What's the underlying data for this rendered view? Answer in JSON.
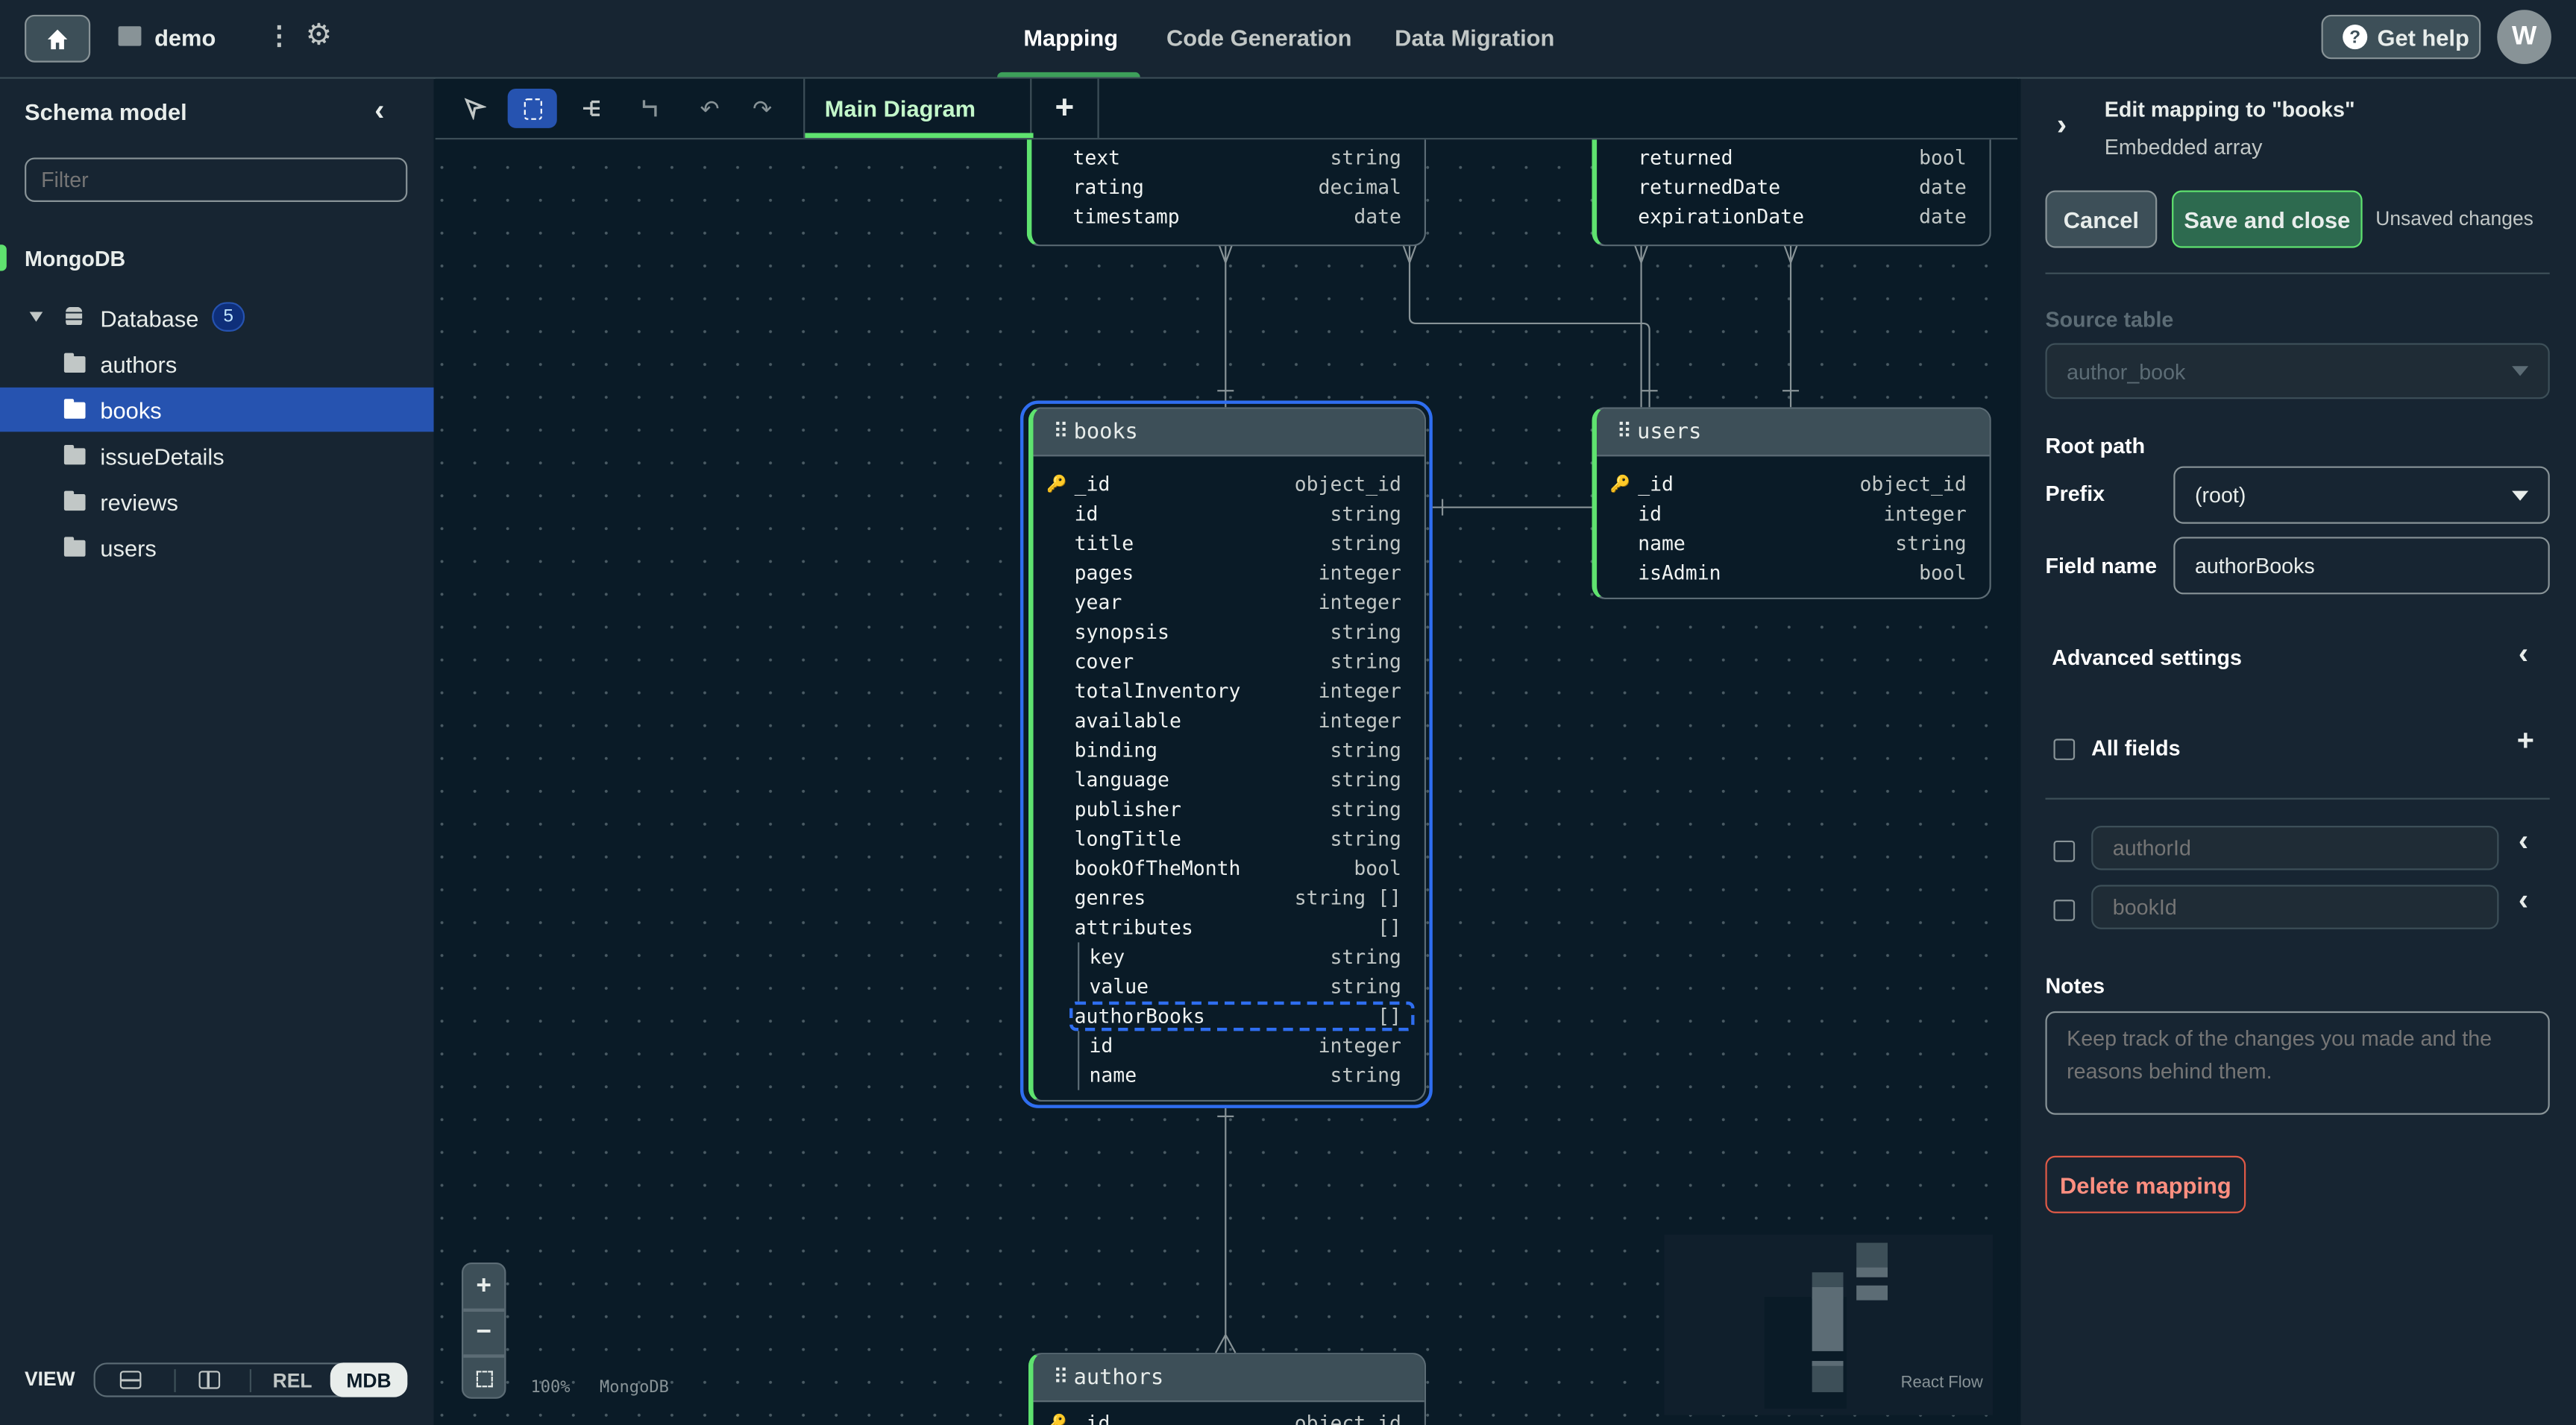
{
  "topbar": {
    "project": "demo",
    "tabs": [
      {
        "label": "Mapping",
        "active": true
      },
      {
        "label": "Code Generation"
      },
      {
        "label": "Data Migration"
      }
    ],
    "help_label": "Get help",
    "avatar_initial": "W"
  },
  "sidebar": {
    "title": "Schema model",
    "filter_placeholder": "Filter",
    "section": "MongoDB",
    "database": {
      "label": "Database",
      "count": "5"
    },
    "items": [
      {
        "label": "authors"
      },
      {
        "label": "books",
        "selected": true
      },
      {
        "label": "issueDetails"
      },
      {
        "label": "reviews"
      },
      {
        "label": "users"
      }
    ],
    "view_label": "VIEW",
    "view_options": [
      "REL",
      "MDB"
    ],
    "view_selected": "MDB"
  },
  "canvas": {
    "tab": "Main Diagram",
    "zoom": "100%",
    "db_label": "MongoDB",
    "minimap_label": "React Flow",
    "tables": {
      "reviews_partial": {
        "fields": [
          {
            "name": "text",
            "type": "string"
          },
          {
            "name": "rating",
            "type": "decimal"
          },
          {
            "name": "timestamp",
            "type": "date"
          }
        ]
      },
      "issue_partial": {
        "fields": [
          {
            "name": "returned",
            "type": "bool"
          },
          {
            "name": "returnedDate",
            "type": "date"
          },
          {
            "name": "expirationDate",
            "type": "date"
          }
        ]
      },
      "books": {
        "name": "books",
        "fields": [
          {
            "name": "_id",
            "type": "object_id",
            "key": true
          },
          {
            "name": "id",
            "type": "string"
          },
          {
            "name": "title",
            "type": "string"
          },
          {
            "name": "pages",
            "type": "integer"
          },
          {
            "name": "year",
            "type": "integer"
          },
          {
            "name": "synopsis",
            "type": "string"
          },
          {
            "name": "cover",
            "type": "string"
          },
          {
            "name": "totalInventory",
            "type": "integer"
          },
          {
            "name": "available",
            "type": "integer"
          },
          {
            "name": "binding",
            "type": "string"
          },
          {
            "name": "language",
            "type": "string"
          },
          {
            "name": "publisher",
            "type": "string"
          },
          {
            "name": "longTitle",
            "type": "string"
          },
          {
            "name": "bookOfTheMonth",
            "type": "bool"
          },
          {
            "name": "genres",
            "type": "string []"
          },
          {
            "name": "attributes",
            "type": "[]"
          },
          {
            "name": "key",
            "type": "string",
            "nested": true
          },
          {
            "name": "value",
            "type": "string",
            "nested": true
          },
          {
            "name": "authorBooks",
            "type": "[]",
            "highlighted": true
          },
          {
            "name": "id",
            "type": "integer",
            "nested": true
          },
          {
            "name": "name",
            "type": "string",
            "nested": true
          }
        ]
      },
      "users": {
        "name": "users",
        "fields": [
          {
            "name": "_id",
            "type": "object_id",
            "key": true
          },
          {
            "name": "id",
            "type": "integer"
          },
          {
            "name": "name",
            "type": "string"
          },
          {
            "name": "isAdmin",
            "type": "bool"
          }
        ]
      },
      "authors": {
        "name": "authors",
        "fields": [
          {
            "name": "_id",
            "type": "object_id",
            "key": true
          }
        ]
      }
    }
  },
  "panel": {
    "title": "Edit mapping to \"books\"",
    "subtitle": "Embedded array",
    "cancel": "Cancel",
    "save": "Save and close",
    "status": "Unsaved changes",
    "source_label": "Source table",
    "source_value": "author_book",
    "root_path": "Root path",
    "prefix_label": "Prefix",
    "prefix_value": "(root)",
    "field_name_label": "Field name",
    "field_name_value": "authorBooks",
    "advanced": "Advanced settings",
    "all_fields": "All fields",
    "fields": [
      {
        "placeholder": "authorId"
      },
      {
        "placeholder": "bookId"
      }
    ],
    "notes_label": "Notes",
    "notes_placeholder": "Keep track of the changes you made and the reasons behind them.",
    "delete": "Delete mapping"
  },
  "colors": {
    "accent_green": "#5fe26f",
    "selection_blue": "#2653b0",
    "outline_blue": "#2f6ef0",
    "danger": "#e05a47"
  }
}
